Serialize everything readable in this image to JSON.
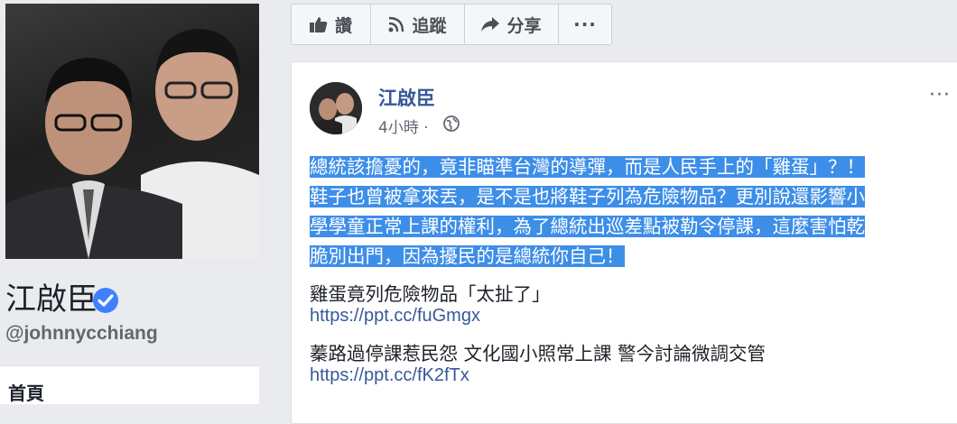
{
  "profile": {
    "name": "江啟臣",
    "username": "@johnnycchiang"
  },
  "nav": {
    "home_label": "首頁"
  },
  "actions": {
    "like": "讚",
    "follow": "追蹤",
    "share": "分享",
    "more": "···"
  },
  "post": {
    "author": "江啟臣",
    "time": "4小時 ·",
    "options": "···",
    "text_lines": [
      "總統該擔憂的，竟非瞄準台灣的導彈，而是人民手上的「雞蛋」？！",
      "鞋子也曾被拿來丟，是不是也將鞋子列為危險物品？更別說還影響小",
      "學學童正常上課的權利，為了總統出巡差點被勒令停課，這麼害怕乾",
      "脆別出門，因為擾民的是總統你自己！"
    ],
    "links": [
      {
        "title": "雞蛋竟列危險物品「太扯了」",
        "url": "https://ppt.cc/fuGmgx"
      },
      {
        "title": "蓁路過停課惹民怨 文化國小照常上課 警今討論微調交管",
        "url": "https://ppt.cc/fK2fTx"
      }
    ]
  },
  "colors": {
    "link": "#365899",
    "highlight": "#3d8ee8",
    "verified": "#4080ff",
    "page_bg": "#e9ebee"
  }
}
